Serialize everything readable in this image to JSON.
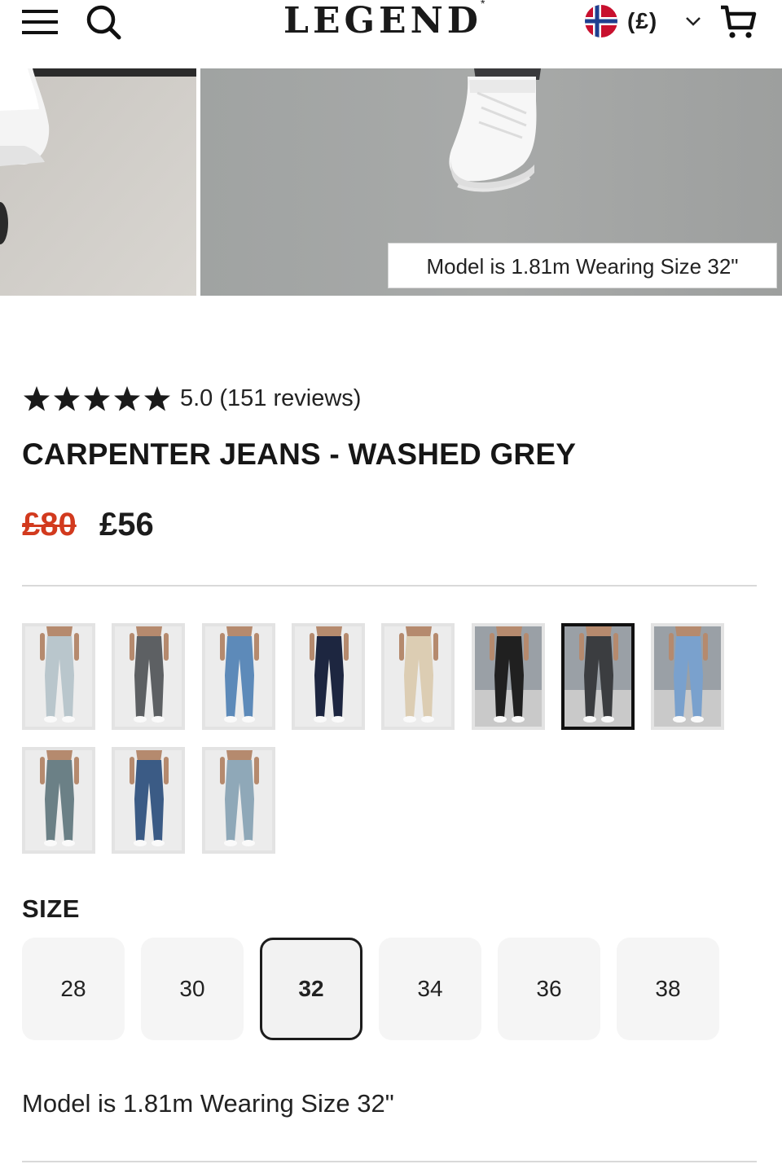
{
  "header": {
    "logo": "LEGEND",
    "logo_mark": "*",
    "currency": "(£)",
    "icons": {
      "menu": "hamburger-menu-icon",
      "search": "search-icon",
      "flag": "norway-flag-icon",
      "chevron": "chevron-down-icon",
      "cart": "cart-icon"
    }
  },
  "hero": {
    "caption": "Model is 1.81m Wearing Size 32\""
  },
  "product": {
    "rating_text": "5.0 (151 reviews)",
    "star_count": 5,
    "title": "CARPENTER JEANS - WASHED GREY",
    "price_old": "£80",
    "price_new": "£56",
    "price_old_color": "#d23a1e"
  },
  "colors": {
    "selected_index": 6,
    "swatches": [
      {
        "name": "light-wash",
        "color": "#b9c6cc"
      },
      {
        "name": "dark-grey",
        "color": "#5d6063"
      },
      {
        "name": "mid-blue",
        "color": "#5d8ab9"
      },
      {
        "name": "navy",
        "color": "#1d2640"
      },
      {
        "name": "sand",
        "color": "#dccdb3"
      },
      {
        "name": "black",
        "color": "#202020"
      },
      {
        "name": "washed-grey",
        "color": "#3b3d40"
      },
      {
        "name": "light-blue",
        "color": "#7aa1cd"
      },
      {
        "name": "vintage-green-wash",
        "color": "#6b8086"
      },
      {
        "name": "dark-blue",
        "color": "#3b5b85"
      },
      {
        "name": "ice-blue",
        "color": "#8fa8b8"
      }
    ]
  },
  "sizes": {
    "heading": "SIZE",
    "options": [
      "28",
      "30",
      "32",
      "34",
      "36",
      "38"
    ],
    "selected": "32"
  },
  "model_note": "Model is 1.81m Wearing Size 32\""
}
